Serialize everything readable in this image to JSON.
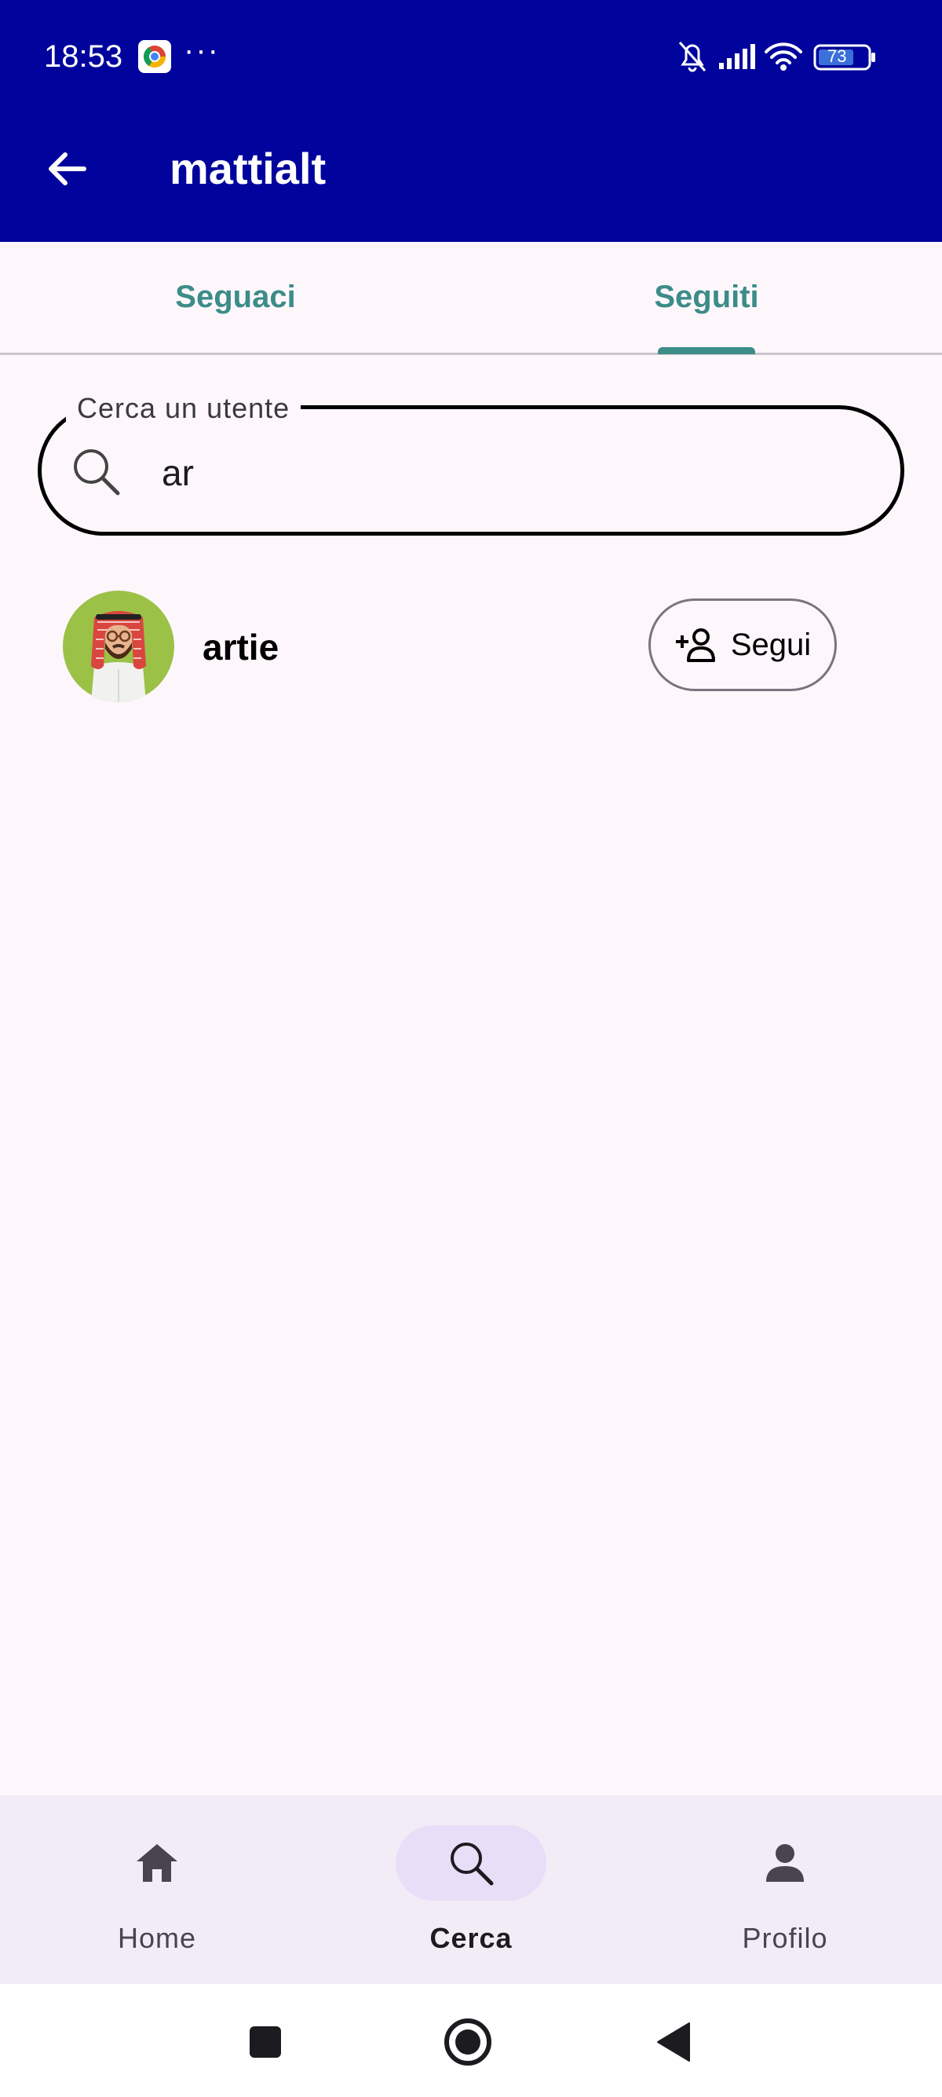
{
  "status_bar": {
    "time": "18:53",
    "dots": "···",
    "battery": "73",
    "icons": [
      "chrome-icon",
      "bell-off-icon",
      "signal-icon",
      "wifi-icon",
      "battery-icon"
    ]
  },
  "app_bar": {
    "title": "mattialt",
    "back_icon": "arrow-left-icon"
  },
  "tabs": [
    {
      "label": "Seguaci",
      "selected": false
    },
    {
      "label": "Seguiti",
      "selected": true
    }
  ],
  "search": {
    "label": "Cerca un utente",
    "value": "ar",
    "icon": "search-icon"
  },
  "results": [
    {
      "username": "artie",
      "action_label": "Segui",
      "action_icon": "person-add-icon"
    }
  ],
  "bottom_nav": [
    {
      "label": "Home",
      "icon": "home-icon",
      "active": false
    },
    {
      "label": "Cerca",
      "icon": "search-icon",
      "active": true
    },
    {
      "label": "Profilo",
      "icon": "person-icon",
      "active": false
    }
  ],
  "colors": {
    "app_bar": "#00049c",
    "tab_accent": "#3c8c88",
    "background": "#fdf7fc",
    "nav_background": "#f2ecf6",
    "nav_active_pill": "#e8def8",
    "avatar_background": "#9bc146"
  }
}
